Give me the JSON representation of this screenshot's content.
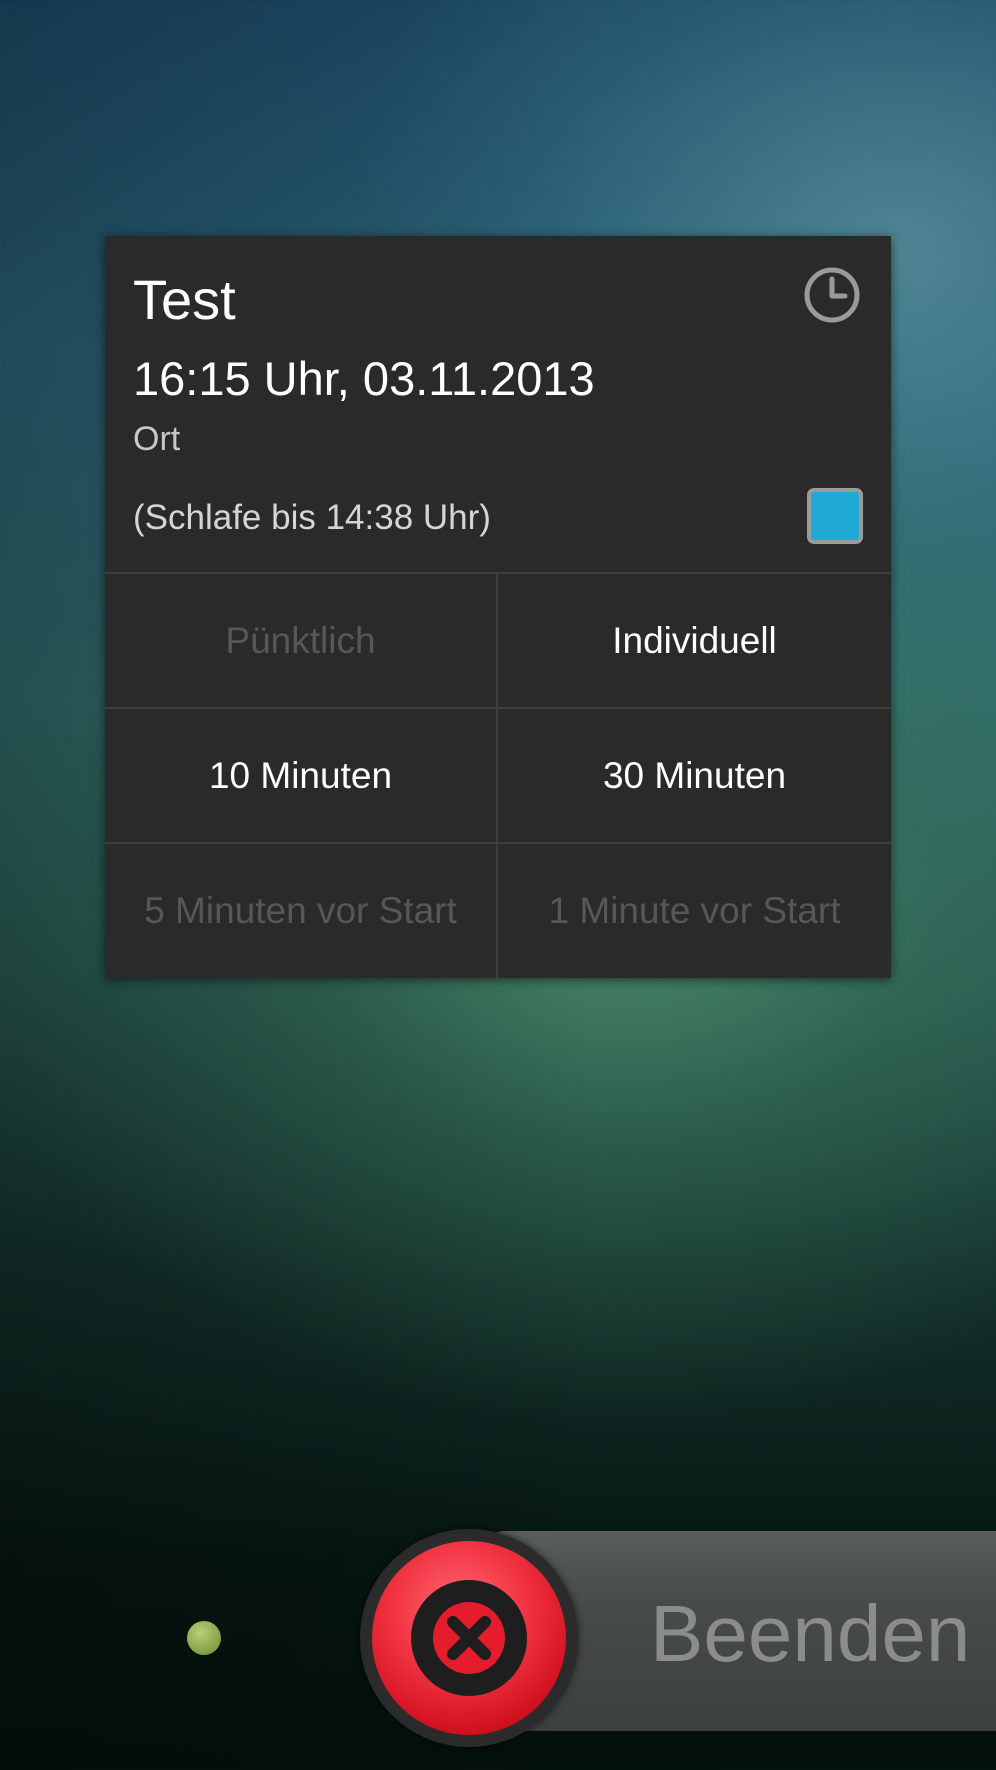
{
  "event": {
    "title": "Test",
    "datetime": "16:15 Uhr, 03.11.2013",
    "location": "Ort",
    "snooze_info": "(Schlafe bis 14:38 Uhr)",
    "color": "#1faad4",
    "icon": "clock-icon"
  },
  "options": [
    {
      "label": "Pünktlich",
      "enabled": false
    },
    {
      "label": "Individuell",
      "enabled": true
    },
    {
      "label": "10 Minuten",
      "enabled": true
    },
    {
      "label": "30 Minuten",
      "enabled": true
    },
    {
      "label": "5 Minuten vor Start",
      "enabled": false
    },
    {
      "label": "1 Minute vor Start",
      "enabled": false
    }
  ],
  "slider": {
    "end_label": "Beenden",
    "end_icon": "close-icon",
    "end_color": "#e51c2b",
    "indicator_color": "#9cb95c"
  }
}
